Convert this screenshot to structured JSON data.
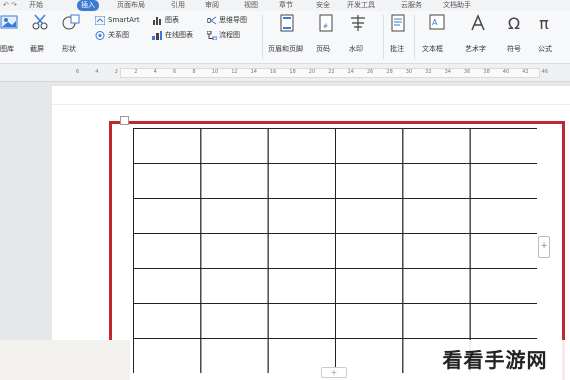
{
  "menu": {
    "tabs": [
      "开始",
      "插入",
      "页面布局",
      "引用",
      "审阅",
      "视图",
      "章节",
      "安全",
      "开发工具",
      "云服务",
      "文档助手"
    ],
    "active_tab": "插入"
  },
  "ribbon": {
    "picture": "图库",
    "screenshot": "截屏",
    "shapes": "形状",
    "smartart": "SmartArt",
    "icons": "图表",
    "mindmap": "思维导图",
    "relation": "关系图",
    "online_chart": "在线图表",
    "flowchart": "流程图",
    "header_footer": "页眉和页脚",
    "page_number": "页码",
    "watermark": "水印",
    "comment": "批注",
    "textbox": "文本框",
    "wordart": "艺术字",
    "symbol": "符号",
    "formula": "公式"
  },
  "ruler": {
    "numbers": [
      "6",
      "4",
      "2",
      "2",
      "4",
      "6",
      "8",
      "10",
      "12",
      "14",
      "16",
      "18",
      "20",
      "22",
      "24",
      "26",
      "28",
      "30",
      "32",
      "34",
      "36",
      "38",
      "40",
      "42",
      "46"
    ]
  },
  "table": {
    "rows": 7,
    "cols": 6
  },
  "controls": {
    "add_col": "+",
    "add_row": "+"
  },
  "watermark": "看看手游网",
  "colors": {
    "accent": "#3a7bd5",
    "highlight": "#c0282d"
  }
}
